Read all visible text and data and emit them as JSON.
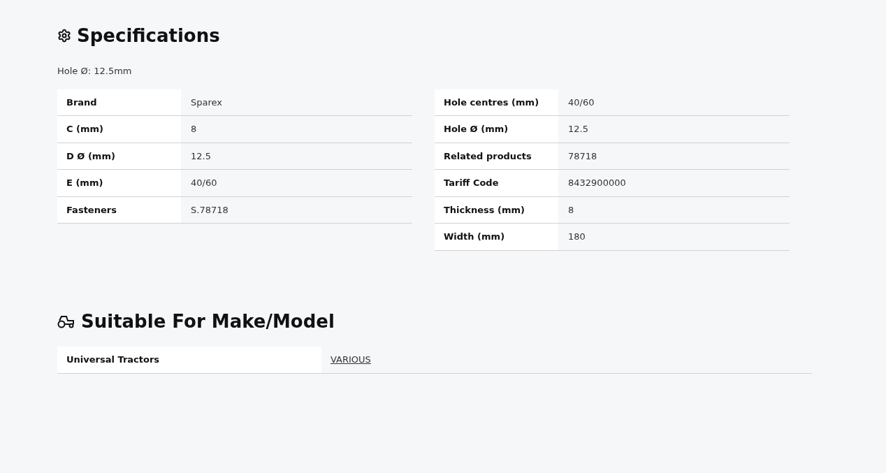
{
  "specifications": {
    "title": "Specifications",
    "note": "Hole Ø: 12.5mm",
    "tables": [
      [
        {
          "label": "Brand",
          "value": "Sparex"
        },
        {
          "label": "C (mm)",
          "value": "8"
        },
        {
          "label": "D Ø (mm)",
          "value": "12.5"
        },
        {
          "label": "E (mm)",
          "value": "40/60"
        },
        {
          "label": "Fasteners",
          "value": "S.78718"
        }
      ],
      [
        {
          "label": "Hole centres (mm)",
          "value": "40/60"
        },
        {
          "label": "Hole Ø (mm)",
          "value": "12.5"
        },
        {
          "label": "Related products",
          "value": "78718"
        },
        {
          "label": "Tariff Code",
          "value": "8432900000"
        },
        {
          "label": "Thickness (mm)",
          "value": "8"
        },
        {
          "label": "Width (mm)",
          "value": "180"
        }
      ]
    ]
  },
  "suitable": {
    "title": "Suitable For Make/Model",
    "rows": [
      {
        "make": "Universal Tractors",
        "model": "VARIOUS"
      }
    ]
  }
}
